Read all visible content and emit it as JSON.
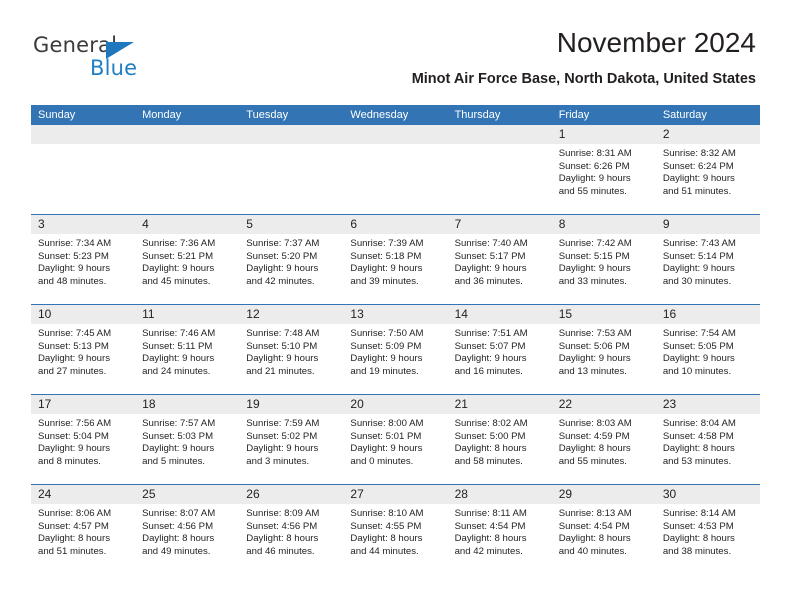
{
  "logo": {
    "word_top": "General",
    "word_bottom": "Blue",
    "triangle_color": "#1f77bd",
    "top_color": "#3b3b3b",
    "bottom_color": "#1f7fc4"
  },
  "header": {
    "title": "November 2024",
    "subtitle": "Minot Air Force Base, North Dakota, United States"
  },
  "theme": {
    "header_blue": "#3274b4",
    "daynum_gray": "#ececec",
    "text": "#231f20"
  },
  "weekdays": [
    "Sunday",
    "Monday",
    "Tuesday",
    "Wednesday",
    "Thursday",
    "Friday",
    "Saturday"
  ],
  "weeks": [
    [
      {
        "day": "",
        "l1": "",
        "l2": "",
        "l3": "",
        "l4": "",
        "empty": true
      },
      {
        "day": "",
        "l1": "",
        "l2": "",
        "l3": "",
        "l4": "",
        "empty": true
      },
      {
        "day": "",
        "l1": "",
        "l2": "",
        "l3": "",
        "l4": "",
        "empty": true
      },
      {
        "day": "",
        "l1": "",
        "l2": "",
        "l3": "",
        "l4": "",
        "empty": true
      },
      {
        "day": "",
        "l1": "",
        "l2": "",
        "l3": "",
        "l4": "",
        "empty": true
      },
      {
        "day": "1",
        "l1": "Sunrise: 8:31 AM",
        "l2": "Sunset: 6:26 PM",
        "l3": "Daylight: 9 hours",
        "l4": "and 55 minutes."
      },
      {
        "day": "2",
        "l1": "Sunrise: 8:32 AM",
        "l2": "Sunset: 6:24 PM",
        "l3": "Daylight: 9 hours",
        "l4": "and 51 minutes."
      }
    ],
    [
      {
        "day": "3",
        "l1": "Sunrise: 7:34 AM",
        "l2": "Sunset: 5:23 PM",
        "l3": "Daylight: 9 hours",
        "l4": "and 48 minutes."
      },
      {
        "day": "4",
        "l1": "Sunrise: 7:36 AM",
        "l2": "Sunset: 5:21 PM",
        "l3": "Daylight: 9 hours",
        "l4": "and 45 minutes."
      },
      {
        "day": "5",
        "l1": "Sunrise: 7:37 AM",
        "l2": "Sunset: 5:20 PM",
        "l3": "Daylight: 9 hours",
        "l4": "and 42 minutes."
      },
      {
        "day": "6",
        "l1": "Sunrise: 7:39 AM",
        "l2": "Sunset: 5:18 PM",
        "l3": "Daylight: 9 hours",
        "l4": "and 39 minutes."
      },
      {
        "day": "7",
        "l1": "Sunrise: 7:40 AM",
        "l2": "Sunset: 5:17 PM",
        "l3": "Daylight: 9 hours",
        "l4": "and 36 minutes."
      },
      {
        "day": "8",
        "l1": "Sunrise: 7:42 AM",
        "l2": "Sunset: 5:15 PM",
        "l3": "Daylight: 9 hours",
        "l4": "and 33 minutes."
      },
      {
        "day": "9",
        "l1": "Sunrise: 7:43 AM",
        "l2": "Sunset: 5:14 PM",
        "l3": "Daylight: 9 hours",
        "l4": "and 30 minutes."
      }
    ],
    [
      {
        "day": "10",
        "l1": "Sunrise: 7:45 AM",
        "l2": "Sunset: 5:13 PM",
        "l3": "Daylight: 9 hours",
        "l4": "and 27 minutes."
      },
      {
        "day": "11",
        "l1": "Sunrise: 7:46 AM",
        "l2": "Sunset: 5:11 PM",
        "l3": "Daylight: 9 hours",
        "l4": "and 24 minutes."
      },
      {
        "day": "12",
        "l1": "Sunrise: 7:48 AM",
        "l2": "Sunset: 5:10 PM",
        "l3": "Daylight: 9 hours",
        "l4": "and 21 minutes."
      },
      {
        "day": "13",
        "l1": "Sunrise: 7:50 AM",
        "l2": "Sunset: 5:09 PM",
        "l3": "Daylight: 9 hours",
        "l4": "and 19 minutes."
      },
      {
        "day": "14",
        "l1": "Sunrise: 7:51 AM",
        "l2": "Sunset: 5:07 PM",
        "l3": "Daylight: 9 hours",
        "l4": "and 16 minutes."
      },
      {
        "day": "15",
        "l1": "Sunrise: 7:53 AM",
        "l2": "Sunset: 5:06 PM",
        "l3": "Daylight: 9 hours",
        "l4": "and 13 minutes."
      },
      {
        "day": "16",
        "l1": "Sunrise: 7:54 AM",
        "l2": "Sunset: 5:05 PM",
        "l3": "Daylight: 9 hours",
        "l4": "and 10 minutes."
      }
    ],
    [
      {
        "day": "17",
        "l1": "Sunrise: 7:56 AM",
        "l2": "Sunset: 5:04 PM",
        "l3": "Daylight: 9 hours",
        "l4": "and 8 minutes."
      },
      {
        "day": "18",
        "l1": "Sunrise: 7:57 AM",
        "l2": "Sunset: 5:03 PM",
        "l3": "Daylight: 9 hours",
        "l4": "and 5 minutes."
      },
      {
        "day": "19",
        "l1": "Sunrise: 7:59 AM",
        "l2": "Sunset: 5:02 PM",
        "l3": "Daylight: 9 hours",
        "l4": "and 3 minutes."
      },
      {
        "day": "20",
        "l1": "Sunrise: 8:00 AM",
        "l2": "Sunset: 5:01 PM",
        "l3": "Daylight: 9 hours",
        "l4": "and 0 minutes."
      },
      {
        "day": "21",
        "l1": "Sunrise: 8:02 AM",
        "l2": "Sunset: 5:00 PM",
        "l3": "Daylight: 8 hours",
        "l4": "and 58 minutes."
      },
      {
        "day": "22",
        "l1": "Sunrise: 8:03 AM",
        "l2": "Sunset: 4:59 PM",
        "l3": "Daylight: 8 hours",
        "l4": "and 55 minutes."
      },
      {
        "day": "23",
        "l1": "Sunrise: 8:04 AM",
        "l2": "Sunset: 4:58 PM",
        "l3": "Daylight: 8 hours",
        "l4": "and 53 minutes."
      }
    ],
    [
      {
        "day": "24",
        "l1": "Sunrise: 8:06 AM",
        "l2": "Sunset: 4:57 PM",
        "l3": "Daylight: 8 hours",
        "l4": "and 51 minutes."
      },
      {
        "day": "25",
        "l1": "Sunrise: 8:07 AM",
        "l2": "Sunset: 4:56 PM",
        "l3": "Daylight: 8 hours",
        "l4": "and 49 minutes."
      },
      {
        "day": "26",
        "l1": "Sunrise: 8:09 AM",
        "l2": "Sunset: 4:56 PM",
        "l3": "Daylight: 8 hours",
        "l4": "and 46 minutes."
      },
      {
        "day": "27",
        "l1": "Sunrise: 8:10 AM",
        "l2": "Sunset: 4:55 PM",
        "l3": "Daylight: 8 hours",
        "l4": "and 44 minutes."
      },
      {
        "day": "28",
        "l1": "Sunrise: 8:11 AM",
        "l2": "Sunset: 4:54 PM",
        "l3": "Daylight: 8 hours",
        "l4": "and 42 minutes."
      },
      {
        "day": "29",
        "l1": "Sunrise: 8:13 AM",
        "l2": "Sunset: 4:54 PM",
        "l3": "Daylight: 8 hours",
        "l4": "and 40 minutes."
      },
      {
        "day": "30",
        "l1": "Sunrise: 8:14 AM",
        "l2": "Sunset: 4:53 PM",
        "l3": "Daylight: 8 hours",
        "l4": "and 38 minutes."
      }
    ]
  ]
}
